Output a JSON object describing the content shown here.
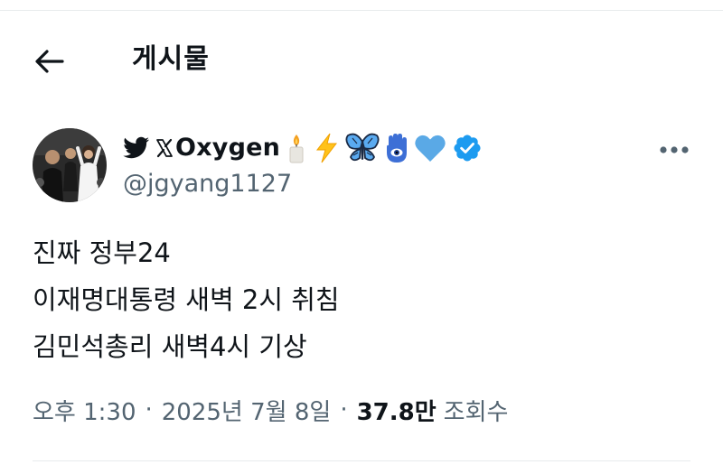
{
  "header": {
    "title": "게시물"
  },
  "post": {
    "author": {
      "display_name": "Oxygen",
      "handle": "@jgyang1127",
      "name_icons": [
        "bird-icon",
        "x-logo-icon",
        "candle-icon",
        "lightning-icon",
        "butterfly-icon",
        "hamsa-icon",
        "blue-heart-icon",
        "verified-badge-icon"
      ]
    },
    "text_lines": [
      "진짜 정부24",
      "이재명대통령 새벽 2시 취침",
      "김민석총리 새벽4시 기상"
    ],
    "meta": {
      "time": "오후 1:30",
      "separator": "·",
      "date": "2025년 7월 8일",
      "views_count": "37.8만",
      "views_label": "조회수"
    }
  },
  "colors": {
    "text_primary": "#0f1419",
    "text_secondary": "#536471",
    "verified_blue": "#1d9bf0",
    "heart_blue": "#5aa9e6",
    "bird_icon": "#0f1419"
  }
}
